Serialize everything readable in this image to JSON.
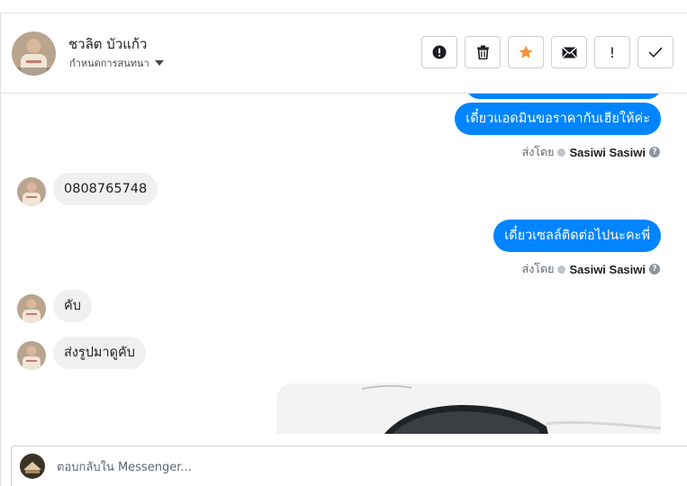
{
  "header": {
    "contact_name": "ชวลิต บัวแก้ว",
    "conversation_settings_label": "กำหนดการสนทนา",
    "actions": [
      {
        "name": "spam-button",
        "icon": "exclamation-circle-icon"
      },
      {
        "name": "delete-button",
        "icon": "trash-icon"
      },
      {
        "name": "star-button",
        "icon": "star-icon",
        "color": "#f7923b"
      },
      {
        "name": "mark-unread-button",
        "icon": "envelope-icon"
      },
      {
        "name": "follow-up-button",
        "label": "!"
      },
      {
        "name": "mark-done-button",
        "icon": "check-icon"
      }
    ]
  },
  "messages": [
    {
      "direction": "out",
      "text": "เดี๋ยวแอดมินขอราคากับเฮียให้ค่ะ",
      "sent_by_label": "ส่งโดย",
      "sender": "Sasiwi Sasiwi"
    },
    {
      "direction": "in",
      "text": "0808765748"
    },
    {
      "direction": "out",
      "text": "เดี๋ยวเซลล์ติดต่อไปนะคะพี่",
      "sent_by_label": "ส่งโดย",
      "sender": "Sasiwi Sasiwi"
    },
    {
      "direction": "in",
      "text": "คับ"
    },
    {
      "direction": "in",
      "text": "ส่งรูปมาดูคับ"
    },
    {
      "direction": "out",
      "type": "photo"
    }
  ],
  "composer": {
    "placeholder": "ตอบกลับใน Messenger..."
  },
  "colors": {
    "outgoing_bubble": "#0084ff",
    "incoming_bubble": "#f1f0f0",
    "star": "#f7923b"
  }
}
